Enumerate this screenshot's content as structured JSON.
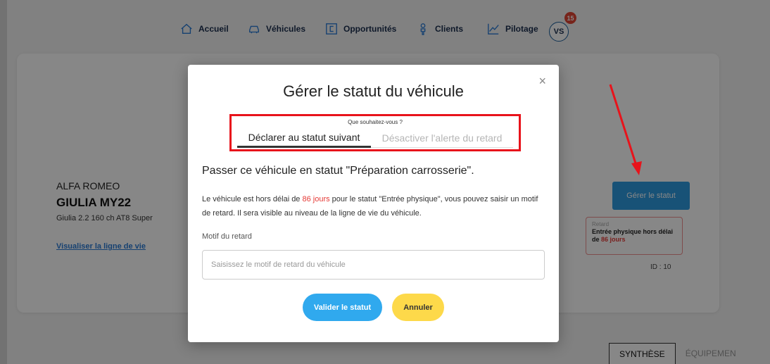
{
  "nav": {
    "items": [
      {
        "label": "Accueil",
        "icon": "home-icon"
      },
      {
        "label": "Véhicules",
        "icon": "car-icon"
      },
      {
        "label": "Opportunités",
        "icon": "opportunity-icon"
      },
      {
        "label": "Clients",
        "icon": "user-icon"
      },
      {
        "label": "Pilotage",
        "icon": "chart-icon"
      }
    ],
    "avatar": "VS",
    "notifications": "15"
  },
  "vehicle": {
    "brand": "ALFA ROMEO",
    "model": "GIULIA MY22",
    "version": "Giulia 2.2 160 ch AT8 Super",
    "lifeline_link": "Visualiser la ligne de vie",
    "status_button": "Gérer le statut",
    "delay": {
      "label": "Retard",
      "text": "Entrée physique hors délai de ",
      "days": "86 jours"
    },
    "id": "ID : 10"
  },
  "bottom_tabs": {
    "active": "SYNTHÈSE",
    "inactive": "ÉQUIPEMEN"
  },
  "modal": {
    "title": "Gérer le statut du véhicule",
    "close": "×",
    "question": "Que souhaitez-vous ?",
    "tabs": [
      "Déclarer au statut suivant",
      "Désactiver l'alerte du retard"
    ],
    "section_title": "Passer ce véhicule en statut \"Préparation carrosserie\".",
    "info_before": "Le véhicule est hors délai de ",
    "info_days": "86 jours",
    "info_after": " pour le statut \"Entrée physique\", vous pouvez saisir un motif de retard. Il sera visible au niveau de la ligne de vie du véhicule.",
    "field_label": "Motif du retard",
    "field_placeholder": "Saisissez le motif de retard du véhicule",
    "validate": "Valider le statut",
    "cancel": "Annuler"
  },
  "colors": {
    "accent_blue": "#30a9ee",
    "cancel_yellow": "#fdd94a",
    "alert_red": "#e53935",
    "annotation_red": "#e8131b"
  }
}
